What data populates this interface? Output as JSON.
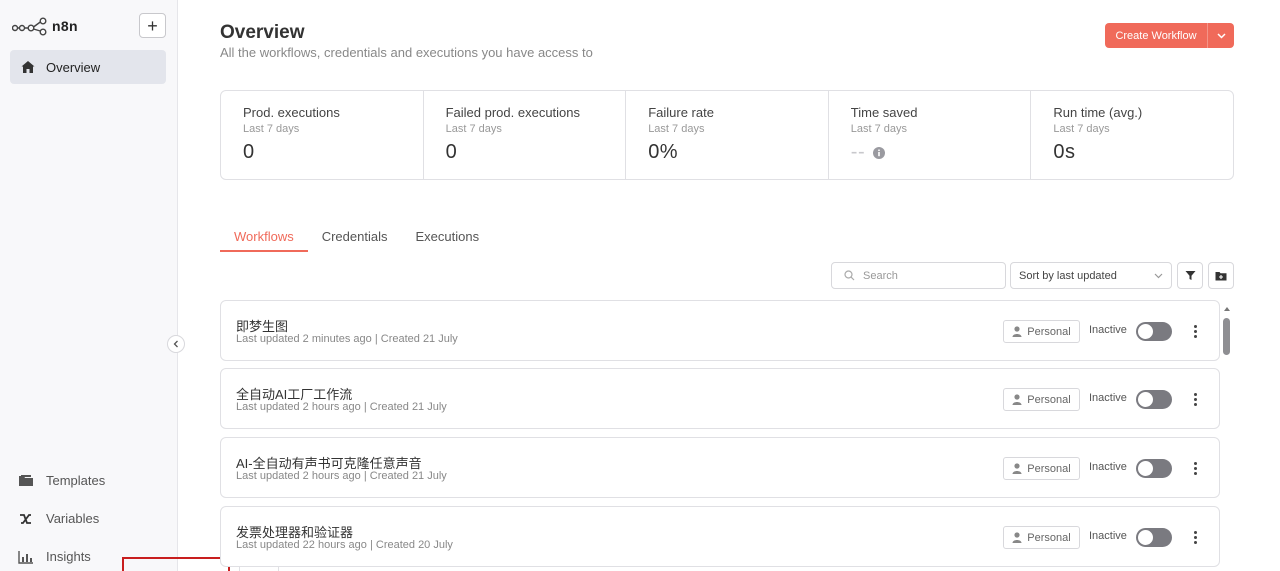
{
  "sidebar": {
    "app_name": "n8n",
    "add_label": "+",
    "active_item": "Overview",
    "bottom_items": [
      "Templates",
      "Variables",
      "Insights"
    ]
  },
  "header": {
    "title": "Overview",
    "subtitle": "All the workflows, credentials and executions you have access to",
    "create_label": "Create Workflow"
  },
  "stats": [
    {
      "label": "Prod. executions",
      "period": "Last 7 days",
      "value": "0"
    },
    {
      "label": "Failed prod. executions",
      "period": "Last 7 days",
      "value": "0"
    },
    {
      "label": "Failure rate",
      "period": "Last 7 days",
      "value": "0%"
    },
    {
      "label": "Time saved",
      "period": "Last 7 days",
      "value": "--"
    },
    {
      "label": "Run time (avg.)",
      "period": "Last 7 days",
      "value": "0s"
    }
  ],
  "tabs": [
    "Workflows",
    "Credentials",
    "Executions"
  ],
  "toolbar": {
    "search_placeholder": "Search",
    "sort_value": "Sort by last updated"
  },
  "workflows": [
    {
      "name": "即梦生图",
      "updated": "Last updated 2 minutes ago",
      "created": "Created 21 July",
      "owner": "Personal",
      "status": "Inactive"
    },
    {
      "name": "全自动AI工厂工作流",
      "updated": "Last updated 2 hours ago",
      "created": "Created 21 July",
      "owner": "Personal",
      "status": "Inactive"
    },
    {
      "name": "AI-全自动有声书可克隆任意声音",
      "updated": "Last updated 2 hours ago",
      "created": "Created 21 July",
      "owner": "Personal",
      "status": "Inactive"
    },
    {
      "name": "发票处理器和验证器",
      "updated": "Last updated 22 hours ago",
      "created": "Created 20 July",
      "owner": "Personal",
      "status": "Inactive"
    }
  ],
  "colors": {
    "accent": "#f06a5a",
    "toggle_off": "#7a7a80",
    "sidebar_bg": "#f8f8fa"
  }
}
